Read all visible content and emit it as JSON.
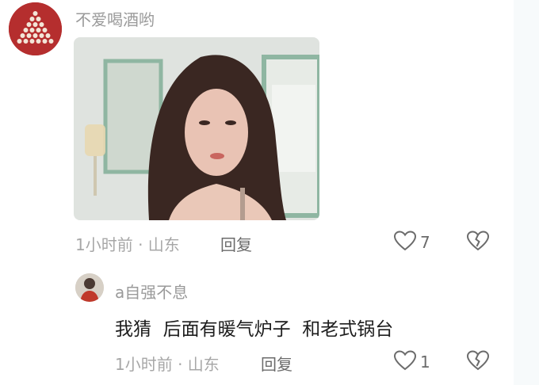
{
  "comment": {
    "username": "不爱喝酒哟",
    "time_location": "1小时前 · 山东",
    "reply_label": "回复",
    "like_count": "7"
  },
  "reply": {
    "username": "a自强不息",
    "text": "我猜  后面有暖气炉子  和老式锅台",
    "time_location": "1小时前 · 山东",
    "reply_label": "回复",
    "like_count": "1"
  },
  "colors": {
    "avatar_red": "#b52e2e",
    "secondary_text": "#a7a7a7",
    "primary_text": "#1d1d1d"
  },
  "icons": {
    "like": "heart-icon",
    "dislike": "broken-heart-icon"
  }
}
